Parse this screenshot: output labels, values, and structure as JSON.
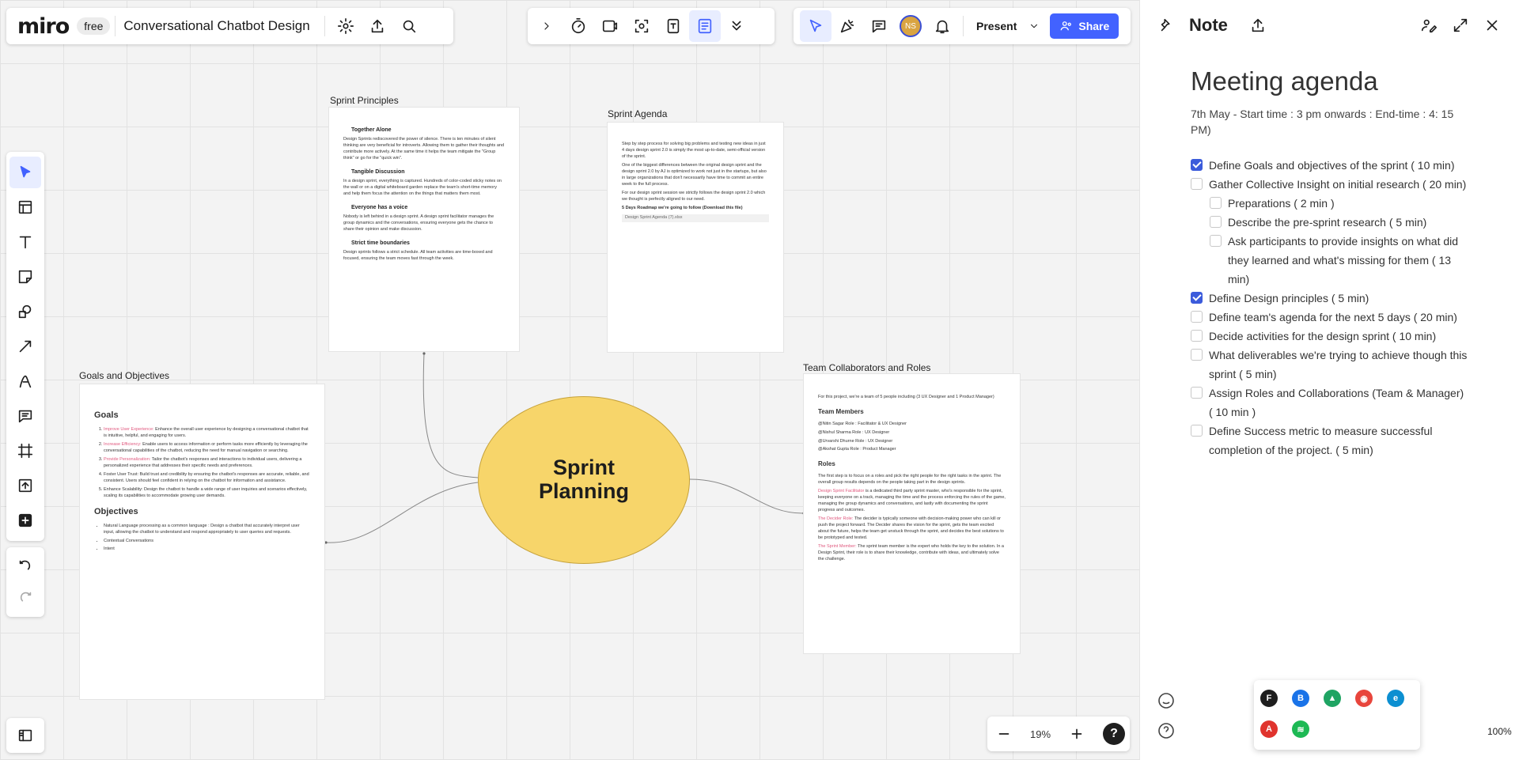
{
  "app": {
    "logo": "miro",
    "plan": "free",
    "board_title": "Conversational Chatbot Design"
  },
  "topbar": {
    "present_label": "Present",
    "share_label": "Share",
    "avatar_initials": "NS"
  },
  "zoom": {
    "level": "19%"
  },
  "frames": {
    "principles": {
      "title": "Sprint Principles",
      "sections": [
        {
          "heading": "Together Alone",
          "text": "Design Sprints rediscovered the power of silence. There is ten minutes of silent thinking are very beneficial for introverts. Allowing them to gather their thoughts and contribute more actively. At the same time it helps the team mitigate the \"Group think\" or go for the \"quick win\"."
        },
        {
          "heading": "Tangible Discussion",
          "text": "In a design sprint, everything is captured. Hundreds of color-coded sticky notes on the wall or on a digital whiteboard garden replace the team's short-time memory and help them focus the attention on the things that matters them most."
        },
        {
          "heading": "Everyone has a voice",
          "text": "Nobody is left behind in a design sprint. A design sprint facilitator manages the group dynamics and the conversations, ensuring everyone gets the chance to share their opinion and make discussion."
        },
        {
          "heading": "Strict time boundaries",
          "text": "Design sprints follows a strict schedule. All team activities are time-boxed and focused, ensuring the team moves fast through the week."
        }
      ]
    },
    "agenda": {
      "title": "Sprint Agenda",
      "paragraphs": [
        "Step by step process for solving big problems and testing new ideas in just 4 days design sprint 2.0 is simply the most up-to-date, semi-official version of the sprint.",
        "One of the biggest differences between the original design sprint and the design sprint 2.0 by AJ is optimized to work not just in the startups, but also in large organizations that don't necessarily have time to commit an entire week to the full process.",
        "For our design sprint session we strictly follows the design sprint 2.0 which we thought is perfectly aligned to our need."
      ],
      "roadmap": "5 Days Roadmap we're going to follow (Download this file)",
      "attachment": "Design Sprint Agenda (7).xlsx"
    },
    "goals": {
      "title": "Goals and Objectives",
      "goals_heading": "Goals",
      "goals": [
        {
          "key": "Improve User Experience:",
          "text": " Enhance the overall user experience by designing a conversational chatbot that is intuitive, helpful, and engaging for users."
        },
        {
          "key": "Increase Efficiency:",
          "text": " Enable users to access information or perform tasks more efficiently by leveraging the conversational capabilities of the chatbot, reducing the need for manual navigation or searching."
        },
        {
          "key": "Provide Personalization:",
          "text": " Tailor the chatbot's responses and interactions to individual users, delivering a personalized experience that addresses their specific needs and preferences."
        },
        {
          "key": "",
          "text": "Foster User Trust: Build trust and credibility by ensuring the chatbot's responses are accurate, reliable, and consistent. Users should feel confident in relying on the chatbot for information and assistance."
        },
        {
          "key": "",
          "text": "Enhance Scalability: Design the chatbot to handle a wide range of user inquiries and scenarios effectively, scaling its capabilities to accommodate growing user demands."
        }
      ],
      "objectives_heading": "Objectives",
      "objectives": [
        "Natural Language processing as a common language : Design a chatbot that accurately interpret user input, allowing the chatbot to understand and respond appropriately to user queries and requests.",
        "Contextual Conversations",
        "Intent"
      ]
    },
    "team": {
      "title": "Team Collaborators and Roles",
      "intro": "For this project, we're a team of 5 people including (3 UX Designer and 1 Product Manager)",
      "members_heading": "Team Members",
      "members": [
        "@Nitin Sagar Role : Facilitator & UX Designer",
        "@Nishul Sharma Role : UX Designer",
        "@Urvarshi Dhurne Role : UX Designer",
        "@Akshat Gupta Role : Product Manager"
      ],
      "roles_heading": "Roles",
      "roles_intro": "The first step is to focus on a roles and pick the right people for the right tasks in the sprint. The overall group results depends on the people taking part in the design sprints.",
      "roles": [
        {
          "key": "Design Sprint Facilitator",
          "text": " is a dedicated third party sprint master, who's responsible for the sprint, keeping everyone on a track, managing the time and the process enforcing the rules of the game, managing the group dynamics and conversations, and lastly with documenting the sprint progress and outcomes."
        },
        {
          "key": "The Decider Role:",
          "text": " The decider is typically someone with decision-making power who can kill or push the project forward. The Decider shares the vision for the sprint, gets the team excited about the future, helps the team get unstuck through the sprint, and decides the best solutions to be prototyped and tested."
        },
        {
          "key": "The Sprint Member:",
          "text": " The sprint team member is the expert who holds the key to the solution. In a Design Sprint, their role is to share their knowledge, contribute with ideas, and ultimately solve the challenge."
        }
      ]
    }
  },
  "center_shape": {
    "text": "Sprint\nPlanning",
    "color": "#f7d56a"
  },
  "note": {
    "panel_title": "Note",
    "heading": "Meeting agenda",
    "subtitle": "7th May - Start time : 3 pm onwards : End-time : 4: 15 PM)",
    "tasks": [
      {
        "text": "Define Goals and objectives of the sprint ( 10 min)",
        "checked": true,
        "indent": false
      },
      {
        "text": "Gather Collective Insight on initial research ( 20 min)",
        "checked": false,
        "indent": false
      },
      {
        "text": "Preparations ( 2 min )",
        "checked": false,
        "indent": true
      },
      {
        "text": "Describe the pre-sprint research ( 5 min)",
        "checked": false,
        "indent": true
      },
      {
        "text": "Ask participants to provide insights on what did they learned and what's missing for them ( 13 min)",
        "checked": false,
        "indent": true
      },
      {
        "text": "Define Design principles ( 5 min)",
        "checked": true,
        "indent": false
      },
      {
        "text": "Define team's agenda for the next 5 days ( 20 min)",
        "checked": false,
        "indent": false
      },
      {
        "text": "Decide activities for the design sprint ( 10 min)",
        "checked": false,
        "indent": false
      },
      {
        "text": "What deliverables we're trying to achieve though this sprint ( 5 min)",
        "checked": false,
        "indent": false
      },
      {
        "text": "Assign Roles and Collaborations (Team & Manager) ( 10 min )",
        "checked": false,
        "indent": false
      },
      {
        "text": "Define Success metric to measure successful completion of the project. ( 5 min)",
        "checked": false,
        "indent": false
      }
    ]
  },
  "tray_apps": [
    "figma-icon",
    "bluetooth-icon",
    "drive-icon",
    "chrome-icon",
    "edge-icon",
    "adobe-icon",
    "spotify-icon"
  ],
  "panel_zoom": "100%"
}
